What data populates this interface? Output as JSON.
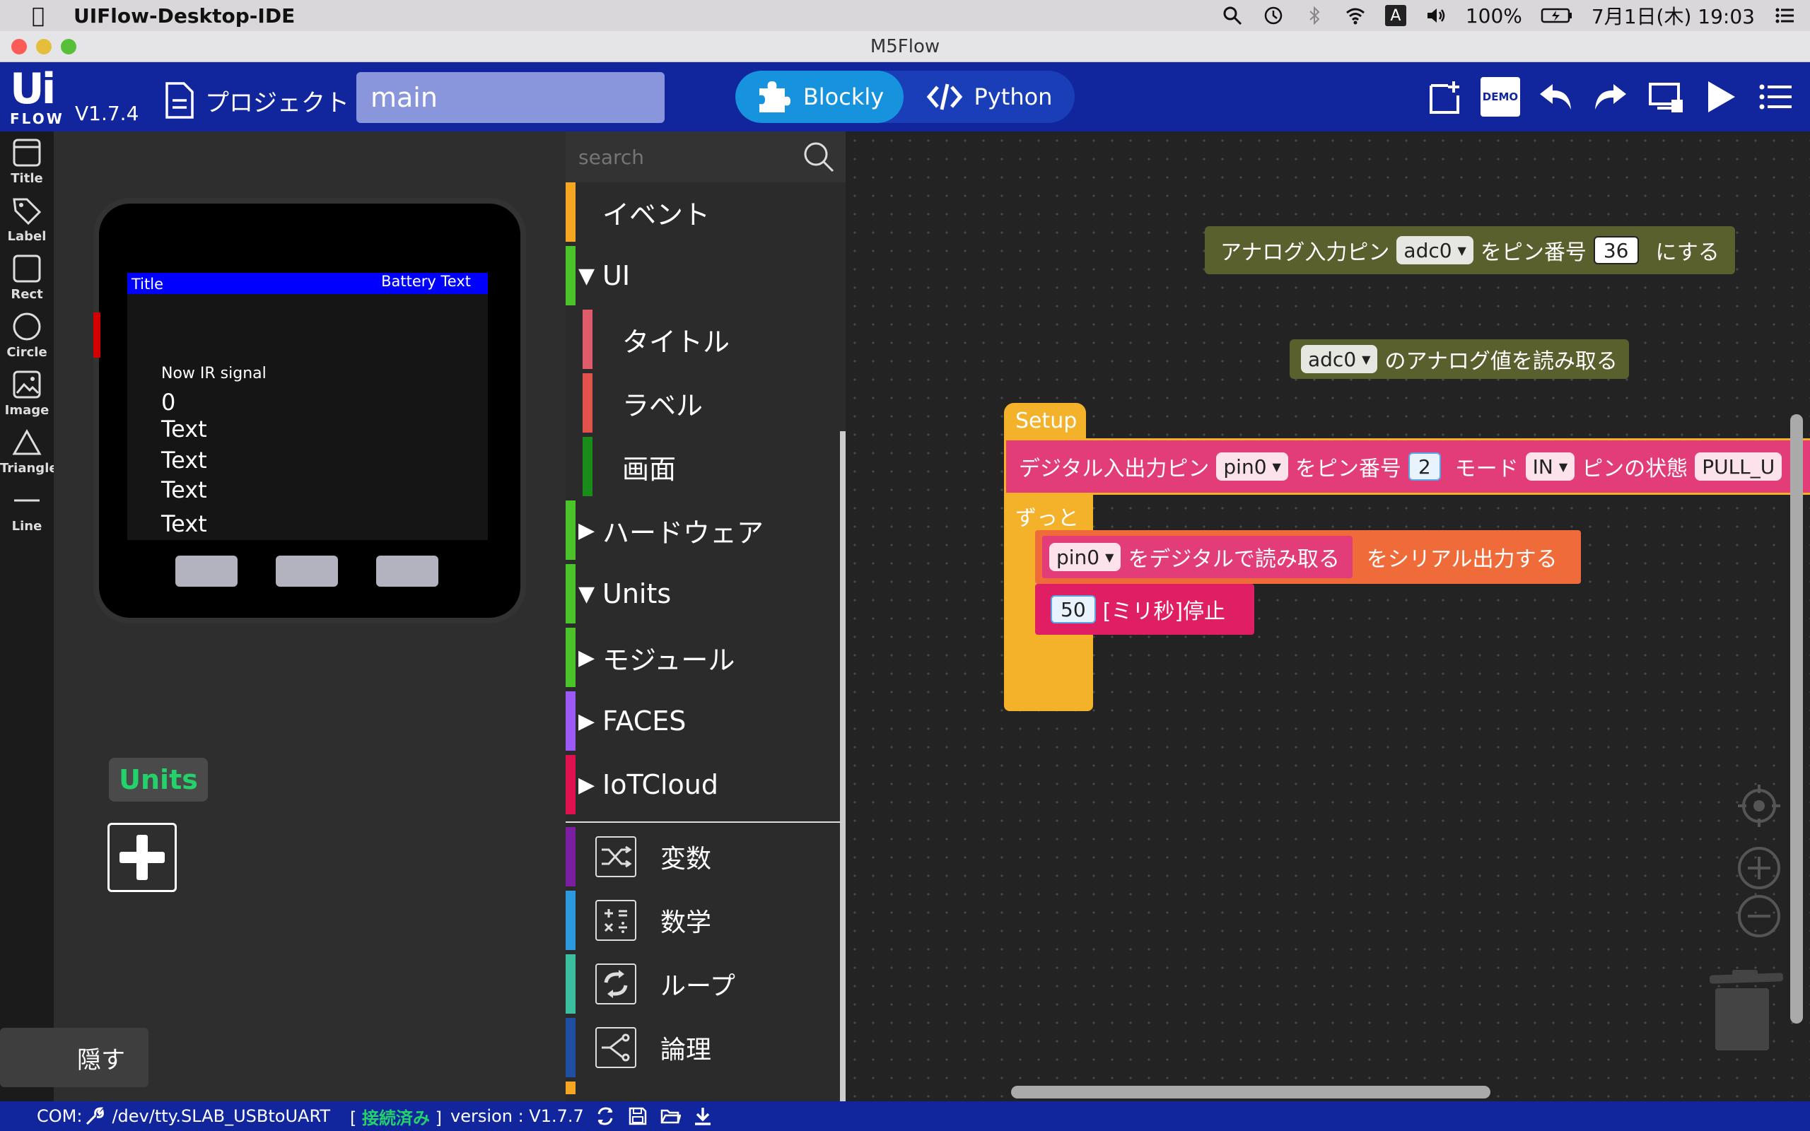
{
  "menubar": {
    "app_name": "UIFlow-Desktop-IDE",
    "battery": "100%",
    "ime": "A",
    "datetime": "7月1日(木) 19:03"
  },
  "window": {
    "title": "M5Flow"
  },
  "header": {
    "logo_ui": "Ui",
    "logo_flow": "FLOW",
    "version": "V1.7.4",
    "project_label": "プロジェクト",
    "file_name": "main",
    "tabs": [
      {
        "label": "Blockly",
        "active": true
      },
      {
        "label": "Python",
        "active": false
      }
    ],
    "demo_label": "DEMO"
  },
  "toolstrip": {
    "items": [
      {
        "label": "Title",
        "icon": "title-icon"
      },
      {
        "label": "Label",
        "icon": "label-icon"
      },
      {
        "label": "Rect",
        "icon": "rect-icon"
      },
      {
        "label": "Circle",
        "icon": "circle-icon"
      },
      {
        "label": "Image",
        "icon": "image-icon"
      },
      {
        "label": "Triangle",
        "icon": "triangle-icon"
      },
      {
        "label": "Line",
        "icon": "line-icon"
      }
    ]
  },
  "device": {
    "title_text": "Title",
    "battery_text": "Battery Text",
    "labels": [
      "Now IR signal",
      "0",
      "Text",
      "Text",
      "Text",
      "Text"
    ]
  },
  "units_panel": {
    "label": "Units",
    "hide_label": "隠す"
  },
  "palette": {
    "search_placeholder": "search",
    "categories": [
      {
        "label": "イベント",
        "color": "#f5a623"
      },
      {
        "label": "UI",
        "color": "#4bc42b",
        "expanded": true
      },
      {
        "label": "タイトル",
        "color": "#e05c6c",
        "sub": true
      },
      {
        "label": "ラベル",
        "color": "#e3524a",
        "sub": true
      },
      {
        "label": "画面",
        "color": "#1a8c1a",
        "sub": true
      },
      {
        "label": "ハードウェア",
        "color": "#4bc42b",
        "expanded": false
      },
      {
        "label": "Units",
        "color": "#4bc42b",
        "expanded": true
      },
      {
        "label": "モジュール",
        "color": "#4bc42b",
        "expanded": false
      },
      {
        "label": "FACES",
        "color": "#9b59f5",
        "expanded": false
      },
      {
        "label": "IoTCloud",
        "color": "#e0114f",
        "expanded": false
      }
    ],
    "standard": [
      {
        "label": "変数",
        "color": "#7a1fa2",
        "icon": "shuffle-icon"
      },
      {
        "label": "数学",
        "color": "#2d9ae0",
        "icon": "math-icon"
      },
      {
        "label": "ループ",
        "color": "#3cbfa1",
        "icon": "loop-icon"
      },
      {
        "label": "論理",
        "color": "#1e4fa3",
        "icon": "logic-icon"
      }
    ]
  },
  "blocks": {
    "analog_pin": {
      "prefix": "アナログ入力ピン",
      "pin": "adc0",
      "mid": "をピン番号",
      "num": "36",
      "suffix": "にする"
    },
    "analog_read": {
      "pin": "adc0",
      "suffix": "のアナログ値を読み取る"
    },
    "setup_label": "Setup",
    "digital_pin": {
      "prefix": "デジタル入出力ピン",
      "pin": "pin0",
      "mid": "をピン番号",
      "num": "2",
      "mode_label": "モード",
      "mode": "IN",
      "state_label": "ピンの状態",
      "state": "PULL_U"
    },
    "loop_label": "ずっと",
    "serial": {
      "pin": "pin0",
      "read": "をデジタルで読み取る",
      "suffix": "をシリアル出力する"
    },
    "wait": {
      "num": "50",
      "suffix": "[ミリ秒]停止"
    }
  },
  "statusbar": {
    "com_label": "COM:",
    "port": "/dev/tty.SLAB_USBtoUART",
    "connected": "接続済み",
    "version": "version : V1.7.7"
  }
}
